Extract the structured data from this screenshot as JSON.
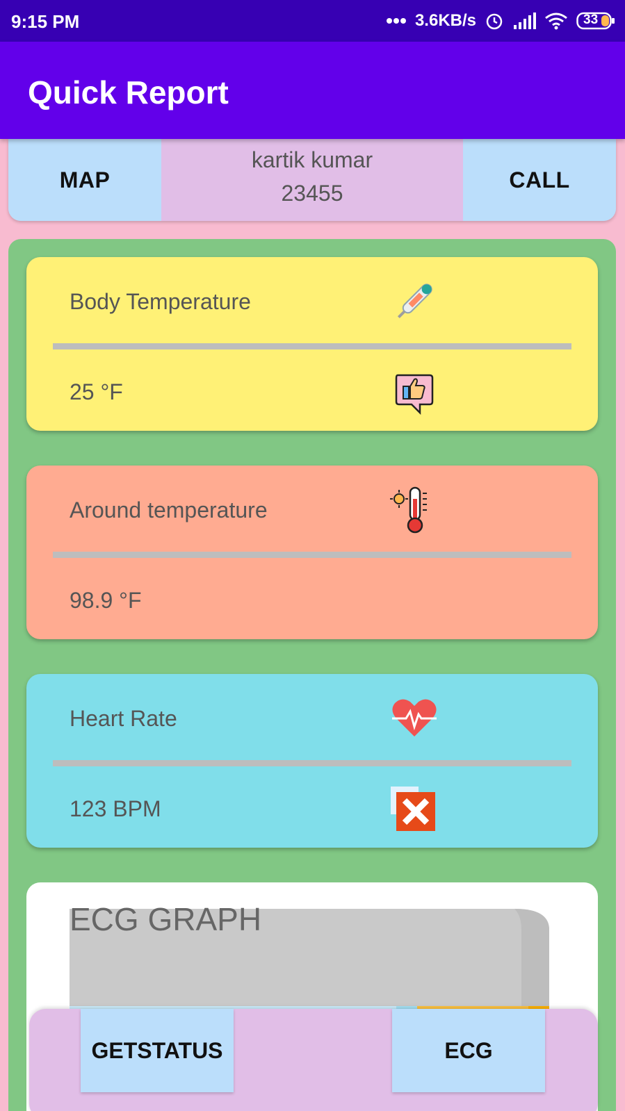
{
  "status_bar": {
    "time": "9:15 PM",
    "network_speed": "3.6KB/s",
    "battery": "33",
    "icons": [
      "more-dots-icon",
      "alarm-icon",
      "signal-icon",
      "wifi-icon",
      "battery-icon"
    ]
  },
  "app_bar": {
    "title": "Quick Report"
  },
  "top_card": {
    "map_label": "MAP",
    "patient_name": "kartik kumar",
    "patient_id": "23455",
    "call_label": "CALL"
  },
  "cards": [
    {
      "label": "Body Temperature",
      "value": "25  °F",
      "color": "#fff176",
      "icon_top": "thermometer-icon",
      "icon_bottom": "thumbs-up-icon"
    },
    {
      "label": "Around temperature",
      "value": "98.9  °F",
      "color": "#ffab91",
      "icon_top": "temperature-gauge-icon"
    },
    {
      "label": "Heart Rate",
      "value": "123  BPM",
      "color": "#80deea",
      "icon_top": "heart-rate-icon",
      "icon_bottom": "error-x-icon"
    }
  ],
  "ecg": {
    "title": "ECG GRAPH"
  },
  "bottom_bar": {
    "getstatus_label": "GETSTATUS",
    "ecg_label": "ECG"
  },
  "colors": {
    "status_bar": "#3700b3",
    "app_bar": "#6200ea",
    "background": "#f8bbd0",
    "panel": "#81c784",
    "button": "#bbdefb",
    "patient_box": "#e1bee7"
  }
}
